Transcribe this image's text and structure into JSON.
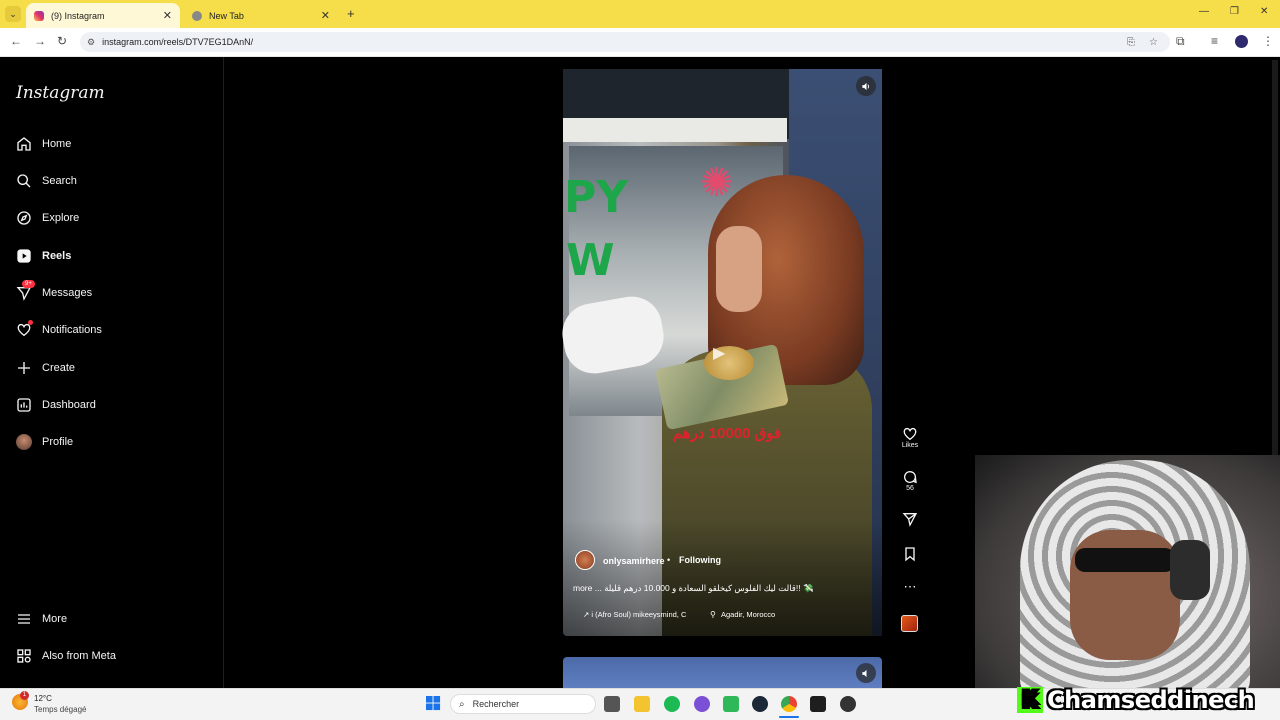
{
  "browser": {
    "tabs": [
      {
        "label": "(9) Instagram",
        "active": true
      },
      {
        "label": "New Tab",
        "active": false
      }
    ],
    "url": "instagram.com/reels/DTV7EG1DAnN/"
  },
  "sidebar": {
    "logo": "Instagram",
    "items": [
      {
        "label": "Home",
        "icon": "home-icon"
      },
      {
        "label": "Search",
        "icon": "search-icon"
      },
      {
        "label": "Explore",
        "icon": "compass-icon"
      },
      {
        "label": "Reels",
        "icon": "reels-icon"
      },
      {
        "label": "Messages",
        "icon": "messenger-icon",
        "badge": "9+"
      },
      {
        "label": "Notifications",
        "icon": "heart-icon"
      },
      {
        "label": "Create",
        "icon": "plus-icon"
      },
      {
        "label": "Dashboard",
        "icon": "dashboard-icon"
      },
      {
        "label": "Profile",
        "icon": "avatar"
      }
    ],
    "bottom": [
      {
        "label": "More",
        "icon": "menu-icon"
      },
      {
        "label": "Also from Meta",
        "icon": "meta-icon"
      }
    ]
  },
  "reel": {
    "overlay_text": "فوق 10000 درهم",
    "username": "onlysamirhere",
    "separator": "•",
    "following": "Following",
    "caption": "more ... قالت ليك الفلوس كيخلقو السعادة و 10.000 درهم قليلة!! 💸",
    "music": "↗ i (Afro Soul)   mikeeysmind, C",
    "location": "Agadir, Morocco"
  },
  "actions": {
    "likes_label": "Likes",
    "comments_count": "56"
  },
  "streamer": {
    "name": "Chamseddinech",
    "k": "K"
  },
  "taskbar": {
    "badge": "1",
    "temperature": "12°C",
    "weather": "Temps dégagé",
    "search_placeholder": "Rechercher"
  },
  "colors": {
    "tabbar": "#f6de4a",
    "notification_red": "#ff3040",
    "kick_green": "#53fc18"
  }
}
